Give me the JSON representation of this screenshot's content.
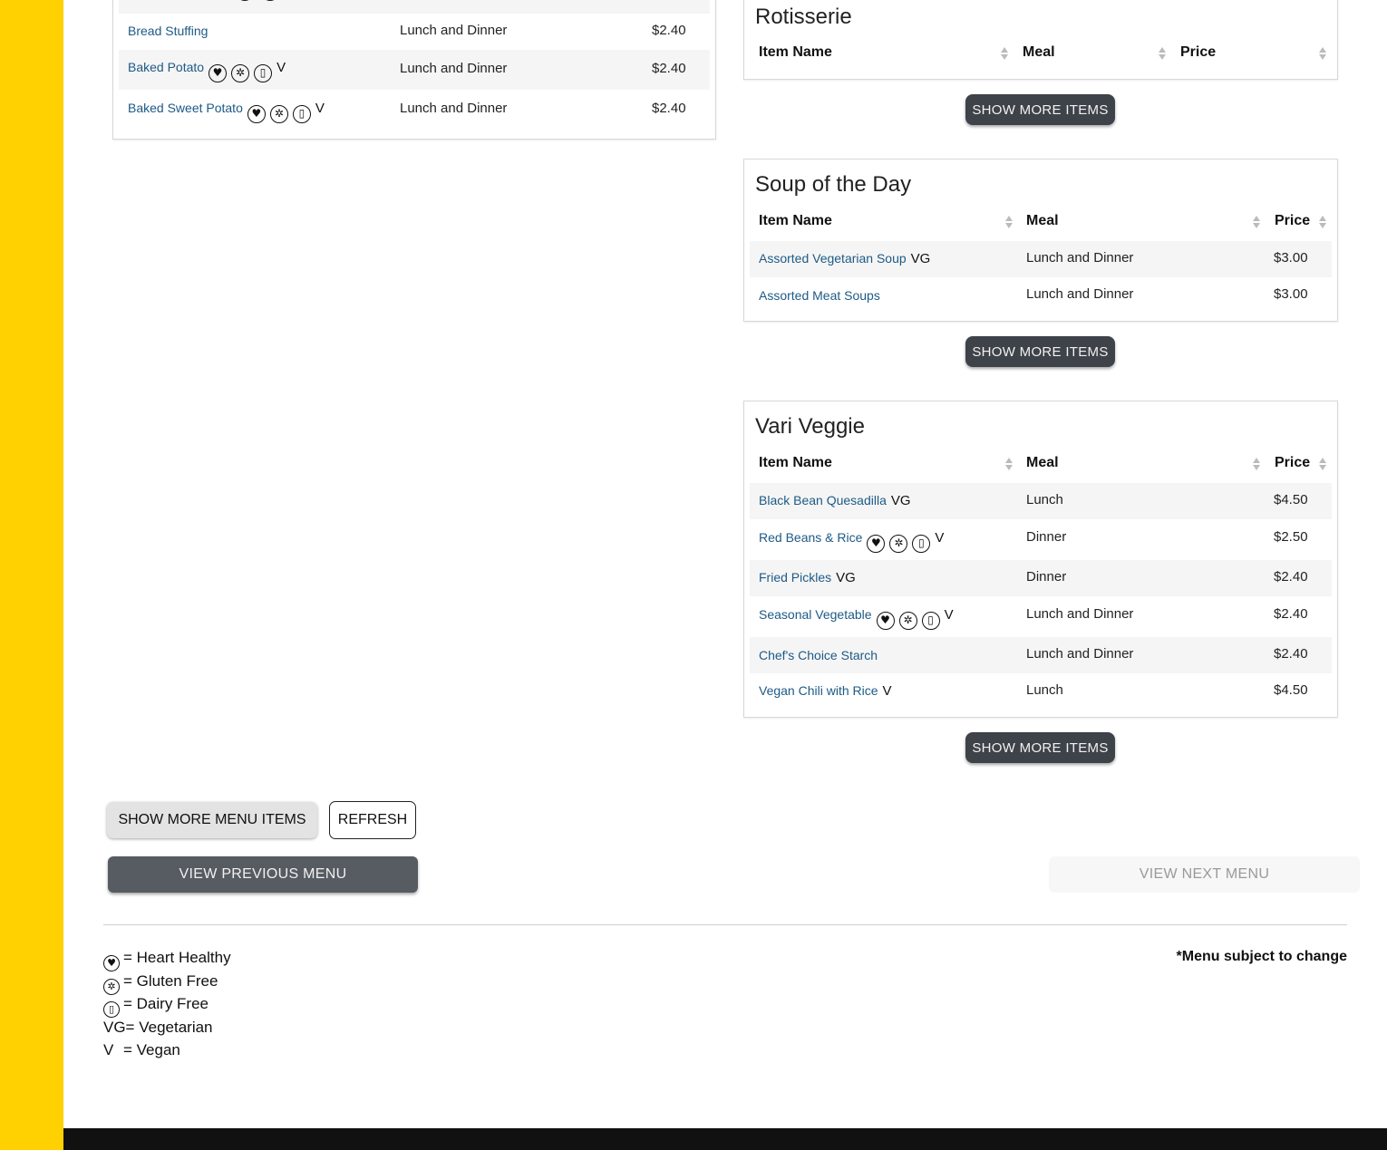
{
  "left_table": {
    "rows": [
      {
        "name": "Bread Stuffing",
        "icons": [],
        "tag": "",
        "meal": "Lunch and Dinner",
        "price": "$2.40"
      },
      {
        "name": "Baked Potato",
        "icons": [
          "heart-healthy",
          "gluten-free",
          "dairy-free"
        ],
        "tag": "V",
        "meal": "Lunch and Dinner",
        "price": "$2.40"
      },
      {
        "name": "Baked Sweet Potato",
        "icons": [
          "heart-healthy",
          "gluten-free",
          "dairy-free"
        ],
        "tag": "V",
        "meal": "Lunch and Dinner",
        "price": "$2.40"
      }
    ]
  },
  "rotisserie": {
    "title": "Rotisserie",
    "headers": {
      "name": "Item Name",
      "meal": "Meal",
      "price": "Price"
    },
    "show_more": "SHOW MORE ITEMS"
  },
  "soup": {
    "title": "Soup of the Day",
    "headers": {
      "name": "Item Name",
      "meal": "Meal",
      "price": "Price"
    },
    "rows": [
      {
        "name": "Assorted Vegetarian Soup",
        "tag": "VG",
        "meal": "Lunch and Dinner",
        "price": "$3.00"
      },
      {
        "name": "Assorted Meat Soups",
        "tag": "",
        "meal": "Lunch and Dinner",
        "price": "$3.00"
      }
    ],
    "show_more": "SHOW MORE ITEMS"
  },
  "vari_veggie": {
    "title": "Vari Veggie",
    "headers": {
      "name": "Item Name",
      "meal": "Meal",
      "price": "Price"
    },
    "rows": [
      {
        "name": "Black Bean Quesadilla",
        "icons": [],
        "tag": "VG",
        "meal": "Lunch",
        "price": "$4.50"
      },
      {
        "name": "Red Beans & Rice",
        "icons": [
          "heart-healthy",
          "gluten-free",
          "dairy-free"
        ],
        "tag": "V",
        "meal": "Dinner",
        "price": "$2.50"
      },
      {
        "name": "Fried Pickles",
        "icons": [],
        "tag": "VG",
        "meal": "Dinner",
        "price": "$2.40"
      },
      {
        "name": "Seasonal Vegetable",
        "icons": [
          "heart-healthy",
          "gluten-free",
          "dairy-free"
        ],
        "tag": "V",
        "meal": "Lunch and Dinner",
        "price": "$2.40"
      },
      {
        "name": "Chef's Choice Starch",
        "icons": [],
        "tag": "",
        "meal": "Lunch and Dinner",
        "price": "$2.40"
      },
      {
        "name": "Vegan Chili with Rice",
        "icons": [],
        "tag": "V",
        "meal": "Lunch",
        "price": "$4.50"
      }
    ],
    "show_more": "SHOW MORE ITEMS"
  },
  "controls": {
    "show_more_menu": "SHOW MORE MENU ITEMS",
    "refresh": "REFRESH",
    "prev_menu": "VIEW PREVIOUS MENU",
    "next_menu": "VIEW NEXT MENU"
  },
  "legend": {
    "heart": "= Heart Healthy",
    "gluten": "= Gluten Free",
    "dairy": "= Dairy Free",
    "vegetarian": "VG= Vegetarian",
    "vegan_mark": "V",
    "vegan": "= Vegan"
  },
  "note": "*Menu subject to change",
  "colors": {
    "sidebar": "#ffd100",
    "link": "#1d5a86",
    "dark_button": "#3e4249",
    "footer": "#111111"
  }
}
